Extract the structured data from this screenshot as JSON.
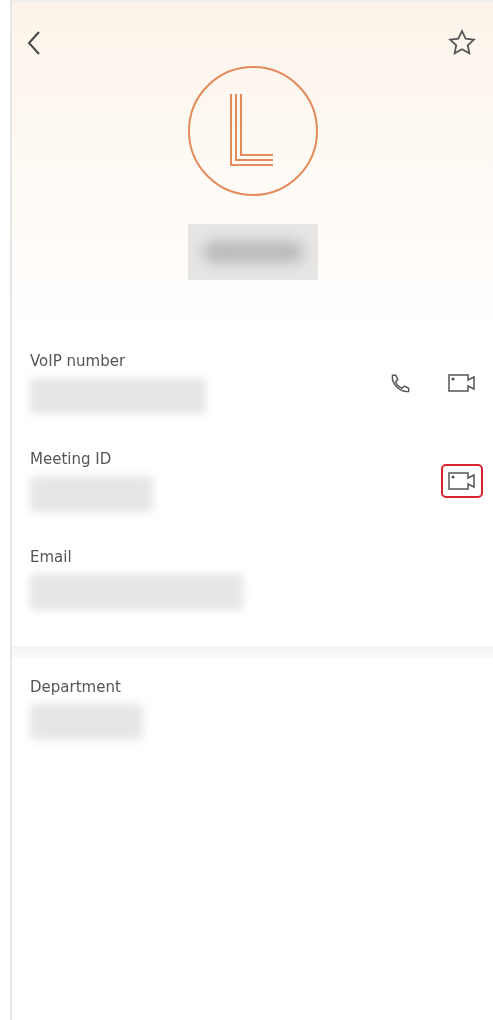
{
  "header": {
    "favorite": false
  },
  "fields": [
    {
      "label": "VoIP number",
      "actions": [
        {
          "kind": "call",
          "highlighted": false
        },
        {
          "kind": "video",
          "highlighted": false
        }
      ]
    },
    {
      "label": "Meeting ID",
      "actions": [
        {
          "kind": "video",
          "highlighted": true
        }
      ]
    },
    {
      "label": "Email"
    }
  ],
  "section_2": [
    {
      "label": "Department"
    }
  ]
}
